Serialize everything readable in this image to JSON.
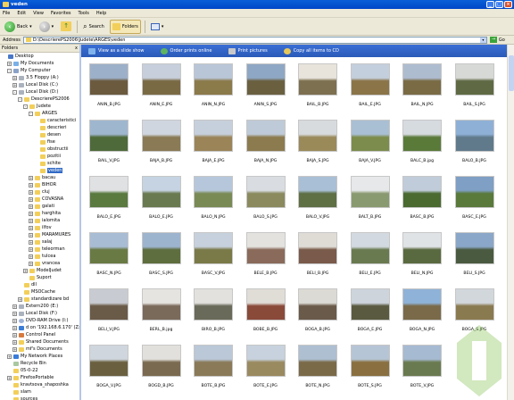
{
  "window": {
    "title": "veden"
  },
  "menu": [
    "File",
    "Edit",
    "View",
    "Favorites",
    "Tools",
    "Help"
  ],
  "toolbar": {
    "back": "Back",
    "search": "Search",
    "folders": "Folders"
  },
  "address": {
    "label": "Address",
    "path": "D:\\DescrierePS2006\\Judete\\ARGES\\veden",
    "go": "Go"
  },
  "left_pane": {
    "header": "Folders",
    "close": "x",
    "tree": [
      {
        "label": "Desktop",
        "indent": 0,
        "toggle": "",
        "icon": "desk"
      },
      {
        "label": "My Documents",
        "indent": 1,
        "toggle": "+",
        "icon": "doc"
      },
      {
        "label": "My Computer",
        "indent": 1,
        "toggle": "-",
        "icon": "comp"
      },
      {
        "label": "3.5 Floppy (A:)",
        "indent": 2,
        "toggle": "+",
        "icon": "drive"
      },
      {
        "label": "Local Disk (C:)",
        "indent": 2,
        "toggle": "+",
        "icon": "drive"
      },
      {
        "label": "Local Disk (D:)",
        "indent": 2,
        "toggle": "-",
        "icon": "drive"
      },
      {
        "label": "DescrierePS2006",
        "indent": 3,
        "toggle": "-",
        "icon": "folder"
      },
      {
        "label": "Judete",
        "indent": 4,
        "toggle": "-",
        "icon": "folder"
      },
      {
        "label": "ARGES",
        "indent": 5,
        "toggle": "-",
        "icon": "folder"
      },
      {
        "label": "caracteristici",
        "indent": 6,
        "toggle": "",
        "icon": "folder"
      },
      {
        "label": "descrieri",
        "indent": 6,
        "toggle": "",
        "icon": "folder"
      },
      {
        "label": "desen",
        "indent": 6,
        "toggle": "",
        "icon": "folder"
      },
      {
        "label": "fise",
        "indent": 6,
        "toggle": "",
        "icon": "folder"
      },
      {
        "label": "obstructii",
        "indent": 6,
        "toggle": "",
        "icon": "folder"
      },
      {
        "label": "pozitii",
        "indent": 6,
        "toggle": "",
        "icon": "folder"
      },
      {
        "label": "schite",
        "indent": 6,
        "toggle": "",
        "icon": "folder"
      },
      {
        "label": "veden",
        "indent": 6,
        "toggle": "",
        "icon": "folder",
        "selected": true
      },
      {
        "label": "bacau",
        "indent": 5,
        "toggle": "+",
        "icon": "folder"
      },
      {
        "label": "BIHOR",
        "indent": 5,
        "toggle": "+",
        "icon": "folder"
      },
      {
        "label": "cluj",
        "indent": 5,
        "toggle": "+",
        "icon": "folder"
      },
      {
        "label": "COVASNA",
        "indent": 5,
        "toggle": "+",
        "icon": "folder"
      },
      {
        "label": "galati",
        "indent": 5,
        "toggle": "+",
        "icon": "folder"
      },
      {
        "label": "harghita",
        "indent": 5,
        "toggle": "+",
        "icon": "folder"
      },
      {
        "label": "ialomita",
        "indent": 5,
        "toggle": "+",
        "icon": "folder"
      },
      {
        "label": "ilfov",
        "indent": 5,
        "toggle": "+",
        "icon": "folder"
      },
      {
        "label": "MARAMURES",
        "indent": 5,
        "toggle": "+",
        "icon": "folder"
      },
      {
        "label": "salaj",
        "indent": 5,
        "toggle": "+",
        "icon": "folder"
      },
      {
        "label": "teleorman",
        "indent": 5,
        "toggle": "+",
        "icon": "folder"
      },
      {
        "label": "tulcea",
        "indent": 5,
        "toggle": "+",
        "icon": "folder"
      },
      {
        "label": "vrancea",
        "indent": 5,
        "toggle": "+",
        "icon": "folder"
      },
      {
        "label": "ModelJudet",
        "indent": 4,
        "toggle": "+",
        "icon": "folder"
      },
      {
        "label": "Suport",
        "indent": 4,
        "toggle": "",
        "icon": "folder"
      },
      {
        "label": "dll",
        "indent": 3,
        "toggle": "",
        "icon": "folder"
      },
      {
        "label": "MSOCache",
        "indent": 3,
        "toggle": "",
        "icon": "folder"
      },
      {
        "label": "standardizare bd",
        "indent": 3,
        "toggle": "+",
        "icon": "folder"
      },
      {
        "label": "Extern200 (E:)",
        "indent": 2,
        "toggle": "+",
        "icon": "drive"
      },
      {
        "label": "Local Disk (F:)",
        "indent": 2,
        "toggle": "+",
        "icon": "drive"
      },
      {
        "label": "DVD-RAM Drive (I:)",
        "indent": 2,
        "toggle": "+",
        "icon": "cd"
      },
      {
        "label": "d on '192.168.6.170' (Z:)",
        "indent": 2,
        "toggle": "+",
        "icon": "net"
      },
      {
        "label": "Control Panel",
        "indent": 2,
        "toggle": "+",
        "icon": "ctrl"
      },
      {
        "label": "Shared Documents",
        "indent": 2,
        "toggle": "+",
        "icon": "folder"
      },
      {
        "label": "mf's Documents",
        "indent": 2,
        "toggle": "+",
        "icon": "folder"
      },
      {
        "label": "My Network Places",
        "indent": 1,
        "toggle": "+",
        "icon": "net"
      },
      {
        "label": "Recycle Bin",
        "indent": 1,
        "toggle": "",
        "icon": "bin"
      },
      {
        "label": "05-0-22",
        "indent": 1,
        "toggle": "",
        "icon": "folder"
      },
      {
        "label": "FirefoxPortable",
        "indent": 1,
        "toggle": "+",
        "icon": "folder"
      },
      {
        "label": "kravtsova_shaposhka",
        "indent": 1,
        "toggle": "",
        "icon": "folder"
      },
      {
        "label": "slam",
        "indent": 1,
        "toggle": "",
        "icon": "folder"
      },
      {
        "label": "sources",
        "indent": 1,
        "toggle": "",
        "icon": "folder"
      }
    ]
  },
  "tasks": [
    "View as a slide show",
    "Order prints online",
    "Print pictures",
    "Copy all items to CD"
  ],
  "files": [
    {
      "name": "ANIN_B.JPG",
      "c1": "#6b5a3e",
      "c2": "#9db0c9"
    },
    {
      "name": "ANIN_E.JPG",
      "c1": "#7a6a44",
      "c2": "#c7cfdc"
    },
    {
      "name": "ANIN_N.JPG",
      "c1": "#8b7a4a",
      "c2": "#b9c6d8"
    },
    {
      "name": "ANIN_S.JPG",
      "c1": "#6a6040",
      "c2": "#8ea7c4"
    },
    {
      "name": "BAIL_B.JPG",
      "c1": "#7d7050",
      "c2": "#e8e4dc"
    },
    {
      "name": "BAIL_E.JPG",
      "c1": "#8a7448",
      "c2": "#c4cfdd"
    },
    {
      "name": "BAIL_N.JPG",
      "c1": "#7a6b45",
      "c2": "#aebcd0"
    },
    {
      "name": "BAIL_S.JPG",
      "c1": "#5f6a44",
      "c2": "#d7d9d6"
    },
    {
      "name": "BAIL_V.JPG",
      "c1": "#4f6a3a",
      "c2": "#9fb6cf"
    },
    {
      "name": "BAJA_B.JPG",
      "c1": "#8a7a55",
      "c2": "#d0d6df"
    },
    {
      "name": "BAJA_E.JPG",
      "c1": "#9a8458",
      "c2": "#c6d0dc"
    },
    {
      "name": "BAJA_N.JPG",
      "c1": "#8c7b4e",
      "c2": "#bfcad8"
    },
    {
      "name": "BAJA_S.JPG",
      "c1": "#9a8a5a",
      "c2": "#d8dbde"
    },
    {
      "name": "BAJA_V.JPG",
      "c1": "#7c8c4c",
      "c2": "#a9bfd4"
    },
    {
      "name": "BALC_B.jpg",
      "c1": "#5a7a3a",
      "c2": "#d6dbe0"
    },
    {
      "name": "BALO_B.JPG",
      "c1": "#607a8c",
      "c2": "#8fb0d6"
    },
    {
      "name": "BALO_E.JPG",
      "c1": "#5a7a40",
      "c2": "#dfe1e3"
    },
    {
      "name": "BALO_E.JPG",
      "c1": "#6a7a50",
      "c2": "#c5d3e2"
    },
    {
      "name": "BALO_N.JPG",
      "c1": "#7a8a55",
      "c2": "#b6c7db"
    },
    {
      "name": "BALO_S.JPG",
      "c1": "#8a8a5e",
      "c2": "#d9dde2"
    },
    {
      "name": "BALO_V.JPG",
      "c1": "#5e7044",
      "c2": "#a9bfd6"
    },
    {
      "name": "BALT_B.JPG",
      "c1": "#8a9a70",
      "c2": "#e6e8ea"
    },
    {
      "name": "BASC_B.JPG",
      "c1": "#4a6a30",
      "c2": "#c0ccd9"
    },
    {
      "name": "BASC_E.JPG",
      "c1": "#5a7a3c",
      "c2": "#7f9fc4"
    },
    {
      "name": "BASC_N.JPG",
      "c1": "#6a7a44",
      "c2": "#a8bcd4"
    },
    {
      "name": "BASC_S.JPG",
      "c1": "#5e6e3e",
      "c2": "#9db4cf"
    },
    {
      "name": "BASC_V.JPG",
      "c1": "#7a7a48",
      "c2": "#c7d1dd"
    },
    {
      "name": "BELE_B.JPG",
      "c1": "#8a6a5a",
      "c2": "#e4e2de"
    },
    {
      "name": "BELI_B.JPG",
      "c1": "#7a5a4a",
      "c2": "#dfdcd6"
    },
    {
      "name": "BELI_E.JPG",
      "c1": "#6a7a50",
      "c2": "#d3d9e0"
    },
    {
      "name": "BELI_N.JPG",
      "c1": "#5a6a40",
      "c2": "#e0e3e6"
    },
    {
      "name": "BELI_S.JPG",
      "c1": "#4a5a40",
      "c2": "#8aa7c9"
    },
    {
      "name": "BELI_V.JPG",
      "c1": "#6a5a48",
      "c2": "#c8ccd2"
    },
    {
      "name": "BERL_B.jpg",
      "c1": "#7a6a5a",
      "c2": "#e6e4e0"
    },
    {
      "name": "BIRO_B.JPG",
      "c1": "#6a6a5a",
      "c2": "#e2e1dd"
    },
    {
      "name": "BOBE_B.JPG",
      "c1": "#8a4a3a",
      "c2": "#e0dcd6"
    },
    {
      "name": "BOGA_B.JPG",
      "c1": "#6a5a4a",
      "c2": "#dcdad4"
    },
    {
      "name": "BOGA_E.JPG",
      "c1": "#5a5a40",
      "c2": "#cdd4dc"
    },
    {
      "name": "BOGA_N.JPG",
      "c1": "#7a6a4a",
      "c2": "#8fb2d8"
    },
    {
      "name": "BOGA_S.JPG",
      "c1": "#8a7a50",
      "c2": "#d2d7dc"
    },
    {
      "name": "BOGA_V.JPG",
      "c1": "#6a6040",
      "c2": "#cfd6de"
    },
    {
      "name": "BOGD_B.JPG",
      "c1": "#7a6a50",
      "c2": "#e2e0dc"
    },
    {
      "name": "BOTE_B.JPG",
      "c1": "#8a7a58",
      "c2": "#bac8d8"
    },
    {
      "name": "BOTE_E.JPG",
      "c1": "#9a8a60",
      "c2": "#c7d2de"
    },
    {
      "name": "BOTE_N.JPG",
      "c1": "#7a6a48",
      "c2": "#aebfd2"
    },
    {
      "name": "BOTE_S.JPG",
      "c1": "#8a7040",
      "c2": "#b6c5d6"
    },
    {
      "name": "BOTE_V.JPG",
      "c1": "#6a7a50",
      "c2": "#a6bad2"
    }
  ]
}
